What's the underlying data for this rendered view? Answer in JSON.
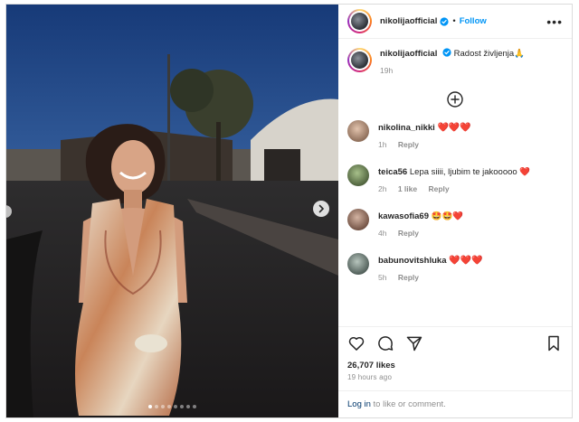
{
  "post": {
    "username": "nikolijaofficial",
    "follow_label": "Follow",
    "more_label": "•••"
  },
  "caption": {
    "username": "nikolijaofficial",
    "text": "Radost življenja🙏",
    "time": "19h"
  },
  "comments": [
    {
      "username": "nikolina_nikki",
      "text": "❤️❤️❤️",
      "time": "1h",
      "likes": "",
      "reply": "Reply",
      "avatar_color": "#b89a86"
    },
    {
      "username": "teica56",
      "text": "Lepa siiii, ljubim te jakooooo ❤️",
      "time": "2h",
      "likes": "1 like",
      "reply": "Reply",
      "avatar_color": "#6d8a58"
    },
    {
      "username": "kawasofia69",
      "text": "🤩🤩❤️",
      "time": "4h",
      "likes": "",
      "reply": "Reply",
      "avatar_color": "#a07d6c"
    },
    {
      "username": "babunovitshluka",
      "text": "❤️❤️❤️",
      "time": "5h",
      "likes": "",
      "reply": "Reply",
      "avatar_color": "#7f8f8a"
    }
  ],
  "likes": "26,707 likes",
  "timestamp": "19 hours ago",
  "login": {
    "link": "Log in",
    "rest": " to like or comment."
  },
  "carousel": {
    "dot_count": 8,
    "active_index": 0
  },
  "colors": {
    "accent": "#0095f6",
    "heart": "#e41e3f",
    "muted": "#8e8e8e"
  }
}
